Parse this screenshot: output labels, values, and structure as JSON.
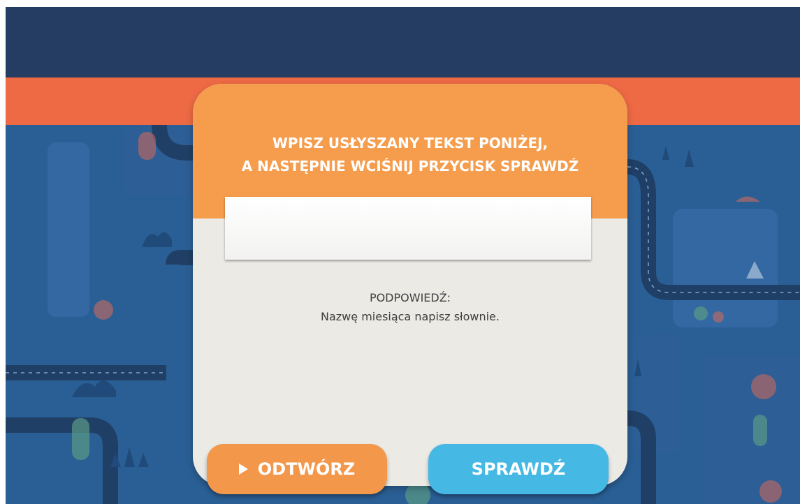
{
  "dialog": {
    "instruction_line1": "WPISZ USŁYSZANY TEKST PONIŻEJ,",
    "instruction_line2": "A NASTĘPNIE WCIŚNIJ PRZYCISK SPRAWDŹ",
    "answer_value": "",
    "hint_title": "PODPOWIEDŹ:",
    "hint_text": "Nazwę miesiąca napisz słownie."
  },
  "buttons": {
    "play_icon": "play-icon",
    "play_label": "ODTWÓRZ",
    "check_label": "SPRAWDŹ"
  },
  "colors": {
    "top_bar": "#253d62",
    "accent_stripe": "#ee6a45",
    "card_header": "#f59c4d",
    "card_body": "#eceae5",
    "play_button": "#f3974b",
    "check_button": "#46b8e4",
    "background": "#2a5f95"
  }
}
